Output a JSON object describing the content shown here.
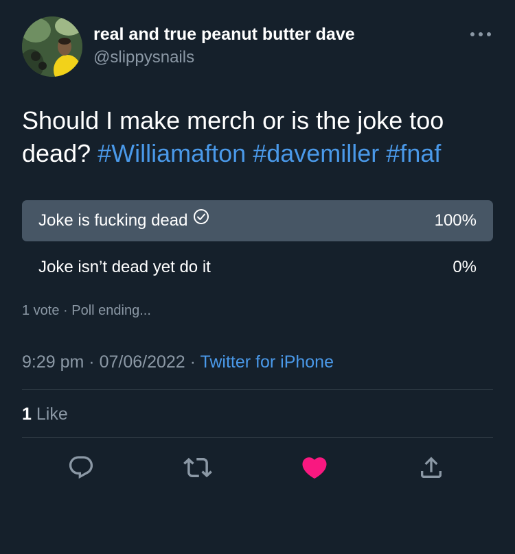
{
  "author": {
    "display_name": "real and true peanut butter dave",
    "handle": "@slippysnails"
  },
  "tweet": {
    "text_plain": "Should I make merch or is the joke too dead? ",
    "hashtags": [
      "#Williamafton",
      "#davemiller",
      "#fnaf"
    ]
  },
  "poll": {
    "options": [
      {
        "label": "Joke is fucking dead",
        "percent": "100%",
        "fill_fraction": 1.0,
        "selected": true
      },
      {
        "label": "Joke isn’t dead yet do it",
        "percent": "0%",
        "fill_fraction": 0.0,
        "selected": false
      }
    ],
    "votes": "1 vote",
    "status": "Poll ending..."
  },
  "meta": {
    "time": "9:29 pm",
    "date": "07/06/2022",
    "source": "Twitter for iPhone"
  },
  "engagement": {
    "likes_count": "1",
    "likes_label": "Like"
  },
  "icons": {
    "more": "more-horizontal-icon",
    "reply": "reply-icon",
    "retweet": "retweet-icon",
    "like": "heart-icon",
    "share": "share-icon",
    "check": "check-circle-icon"
  },
  "colors": {
    "background": "#15202b",
    "accent": "#4a99e9",
    "muted": "#8b98a5",
    "poll_fill": "#475665",
    "like_active": "#f91880"
  }
}
